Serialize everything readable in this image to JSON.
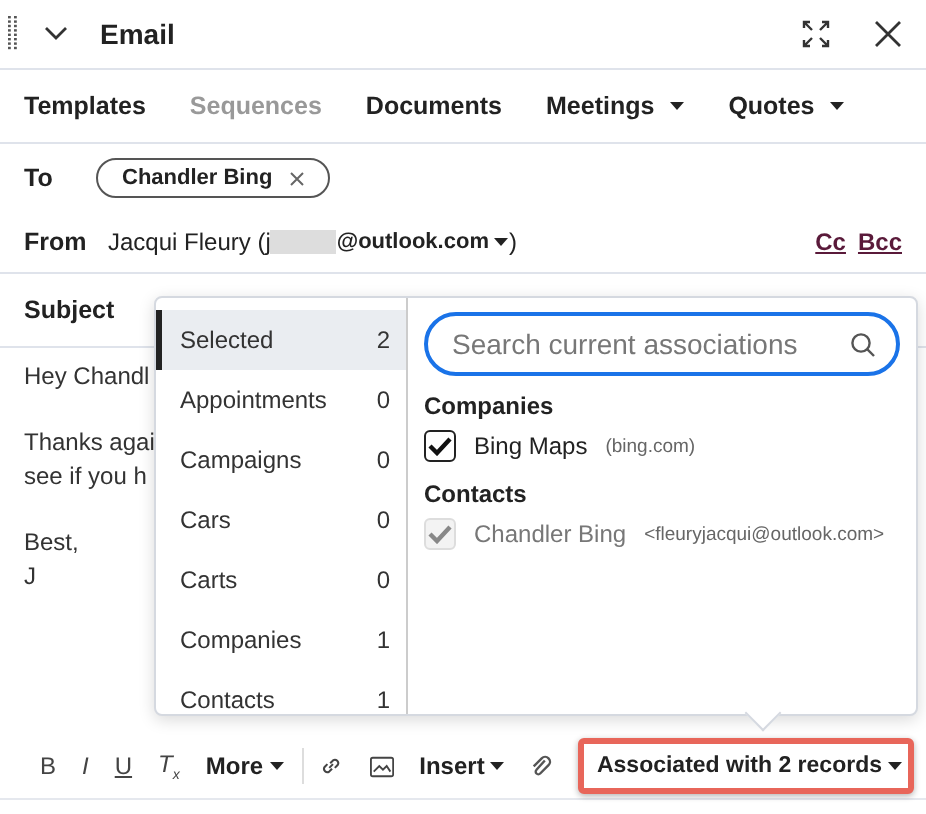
{
  "header": {
    "title": "Email"
  },
  "tabs": [
    {
      "label": "Templates",
      "disabled": false,
      "dropdown": false
    },
    {
      "label": "Sequences",
      "disabled": true,
      "dropdown": false
    },
    {
      "label": "Documents",
      "disabled": false,
      "dropdown": false
    },
    {
      "label": "Meetings",
      "disabled": false,
      "dropdown": true
    },
    {
      "label": "Quotes",
      "disabled": false,
      "dropdown": true
    }
  ],
  "to": {
    "label": "To",
    "recipients": [
      {
        "name": "Chandler Bing"
      }
    ]
  },
  "from": {
    "label": "From",
    "name": "Jacqui Fleury (j",
    "email_end": "@outlook.com",
    "close": ")",
    "links": [
      "Cc",
      "Bcc"
    ]
  },
  "subject": {
    "label": "Subject"
  },
  "body": {
    "paragraphs": [
      [
        "Hey Chandl"
      ],
      [
        "Thanks agai",
        "see if you h"
      ],
      [
        "Best,",
        "J"
      ]
    ]
  },
  "associations": {
    "categories": [
      {
        "label": "Selected",
        "count": "2",
        "selected": true
      },
      {
        "label": "Appointments",
        "count": "0",
        "selected": false
      },
      {
        "label": "Campaigns",
        "count": "0",
        "selected": false
      },
      {
        "label": "Cars",
        "count": "0",
        "selected": false
      },
      {
        "label": "Carts",
        "count": "0",
        "selected": false
      },
      {
        "label": "Companies",
        "count": "1",
        "selected": false
      },
      {
        "label": "Contacts",
        "count": "1",
        "selected": false
      }
    ],
    "search": {
      "placeholder": "Search current associations"
    },
    "groups": [
      {
        "heading": "Companies",
        "items": [
          {
            "name": "Bing Maps",
            "detail": "(bing.com)",
            "checked": true,
            "disabled": false
          }
        ]
      },
      {
        "heading": "Contacts",
        "items": [
          {
            "name": "Chandler Bing",
            "detail": "<fleuryjacqui@outlook.com>",
            "checked": true,
            "disabled": true
          }
        ]
      }
    ]
  },
  "toolbar": {
    "format": [
      {
        "kind": "bold",
        "label": "B"
      },
      {
        "kind": "italic",
        "label": "I"
      },
      {
        "kind": "underline",
        "label": "U"
      },
      {
        "kind": "clear",
        "label": "T$_{x}$"
      }
    ],
    "more": "More",
    "insert": "Insert",
    "associated": "Associated with 2 records"
  }
}
